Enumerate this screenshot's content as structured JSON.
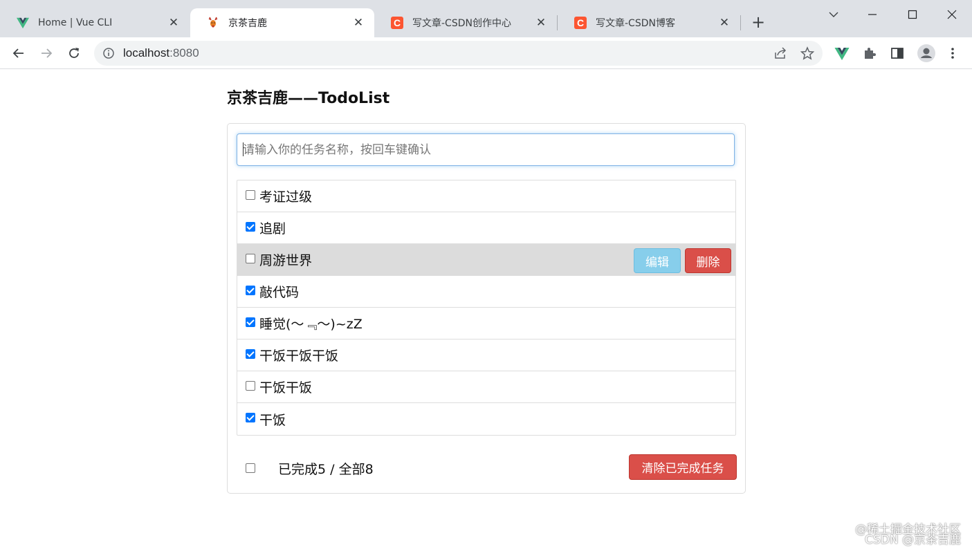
{
  "browser": {
    "tabs": [
      {
        "title": "Home | Vue CLI",
        "icon": "vue-logo-icon",
        "active": false
      },
      {
        "title": "京茶吉鹿",
        "icon": "deer-icon",
        "active": true
      },
      {
        "title": "写文章-CSDN创作中心",
        "icon": "csdn-icon",
        "active": false
      },
      {
        "title": "写文章-CSDN博客",
        "icon": "csdn-icon",
        "active": false
      }
    ],
    "csdn_letter": "C",
    "close_glyph": "✕",
    "new_tab_glyph": "+",
    "url_host": "localhost",
    "url_port": ":8080"
  },
  "app": {
    "title": "京茶吉鹿——TodoList",
    "input_placeholder": "请输入你的任务名称，按回车键确认",
    "todos": [
      {
        "text": "考证过级",
        "done": false
      },
      {
        "text": "追剧",
        "done": true
      },
      {
        "text": "周游世界",
        "done": false
      },
      {
        "text": "敲代码",
        "done": true
      },
      {
        "text": "睡觉(～﹃～)~zZ",
        "done": true
      },
      {
        "text": "干饭干饭干饭",
        "done": true
      },
      {
        "text": "干饭干饭",
        "done": false
      },
      {
        "text": "干饭",
        "done": true
      }
    ],
    "edit_label": "编辑",
    "delete_label": "删除",
    "footer": {
      "stat": "已完成5 / 全部8",
      "clear_label": "清除已完成任务"
    }
  },
  "watermark": {
    "line1": "@稀土掘金技术社区",
    "line2": "CSDN @京茶吉鹿"
  },
  "colors": {
    "checkbox_checked": "#0075ff",
    "edit_button": "#87ceeb",
    "danger_button": "#da4f49",
    "hover_row": "#dcdcdc"
  }
}
